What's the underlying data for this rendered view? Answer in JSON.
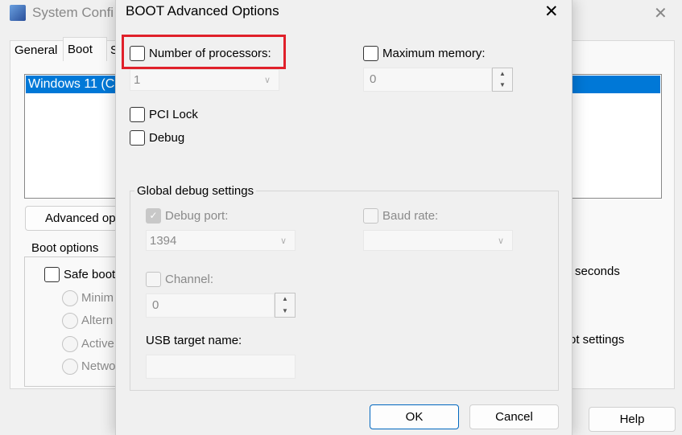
{
  "background_window": {
    "title": "System Confi",
    "tabs": [
      "General",
      "Boot",
      "S"
    ],
    "boot_entry": "Windows 11 (C",
    "advanced_button": "Advanced op",
    "boot_options_label": "Boot options",
    "safe_boot": "Safe boot",
    "radios": [
      "Minim",
      "Altern",
      "Active",
      "Netwo"
    ],
    "seconds_label": "seconds",
    "settings_label": "ot settings",
    "help_button": "Help",
    "close": "✕"
  },
  "dialog": {
    "title": "BOOT Advanced Options",
    "close": "✕",
    "number_of_processors": {
      "label": "Number of processors:",
      "checked": false,
      "value": "1"
    },
    "maximum_memory": {
      "label": "Maximum memory:",
      "checked": false,
      "value": "0"
    },
    "pci_lock": {
      "label": "PCI Lock",
      "checked": false
    },
    "debug": {
      "label": "Debug",
      "checked": false
    },
    "global_debug": {
      "label": "Global debug settings",
      "debug_port": {
        "label": "Debug port:",
        "checked": true,
        "value": "1394"
      },
      "baud_rate": {
        "label": "Baud rate:",
        "checked": false,
        "value": ""
      },
      "channel": {
        "label": "Channel:",
        "checked": false,
        "value": "0"
      },
      "usb_target_name": {
        "label": "USB target name:",
        "value": ""
      }
    },
    "ok": "OK",
    "cancel": "Cancel"
  },
  "highlight_color": "#e0202a",
  "selection_color": "#0078d7"
}
